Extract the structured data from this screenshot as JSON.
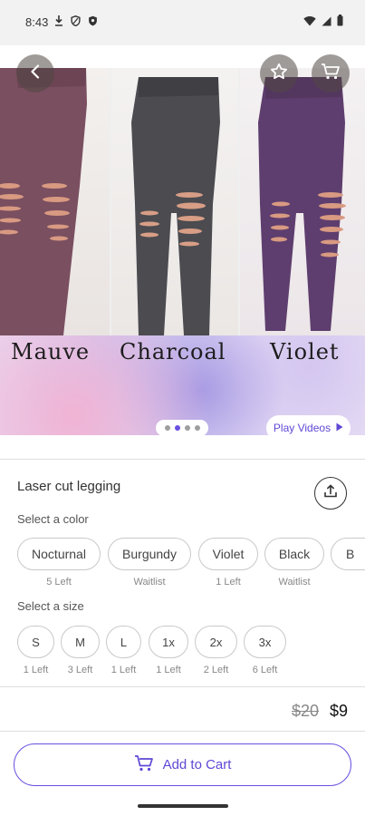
{
  "status_bar": {
    "time": "8:43",
    "left_icons": [
      "download-icon",
      "shield-icon",
      "security-icon"
    ],
    "right_icons": [
      "wifi-icon",
      "signal-icon",
      "battery-icon"
    ]
  },
  "hero": {
    "colors_banner": [
      "Mauve",
      "Charcoal",
      "Violet"
    ],
    "play_videos_label": "Play Videos",
    "carousel": {
      "count": 4,
      "active": 1
    }
  },
  "product": {
    "title": "Laser cut legging",
    "color_label": "Select a color",
    "colors": [
      {
        "name": "Nocturnal",
        "stock": "5 Left"
      },
      {
        "name": "Burgundy",
        "stock": "Waitlist"
      },
      {
        "name": "Violet",
        "stock": "1 Left"
      },
      {
        "name": "Black",
        "stock": "Waitlist"
      },
      {
        "name": "B",
        "stock": ""
      }
    ],
    "size_label": "Select a size",
    "sizes": [
      {
        "name": "S",
        "stock": "1 Left"
      },
      {
        "name": "M",
        "stock": "3 Left"
      },
      {
        "name": "L",
        "stock": "1 Left"
      },
      {
        "name": "1x",
        "stock": "1 Left"
      },
      {
        "name": "2x",
        "stock": "2 Left"
      },
      {
        "name": "3x",
        "stock": "6 Left"
      }
    ],
    "price_original": "$20",
    "price_current": "$9"
  },
  "actions": {
    "add_to_cart": "Add to Cart"
  },
  "theme": {
    "accent": "#6b4fe0"
  }
}
